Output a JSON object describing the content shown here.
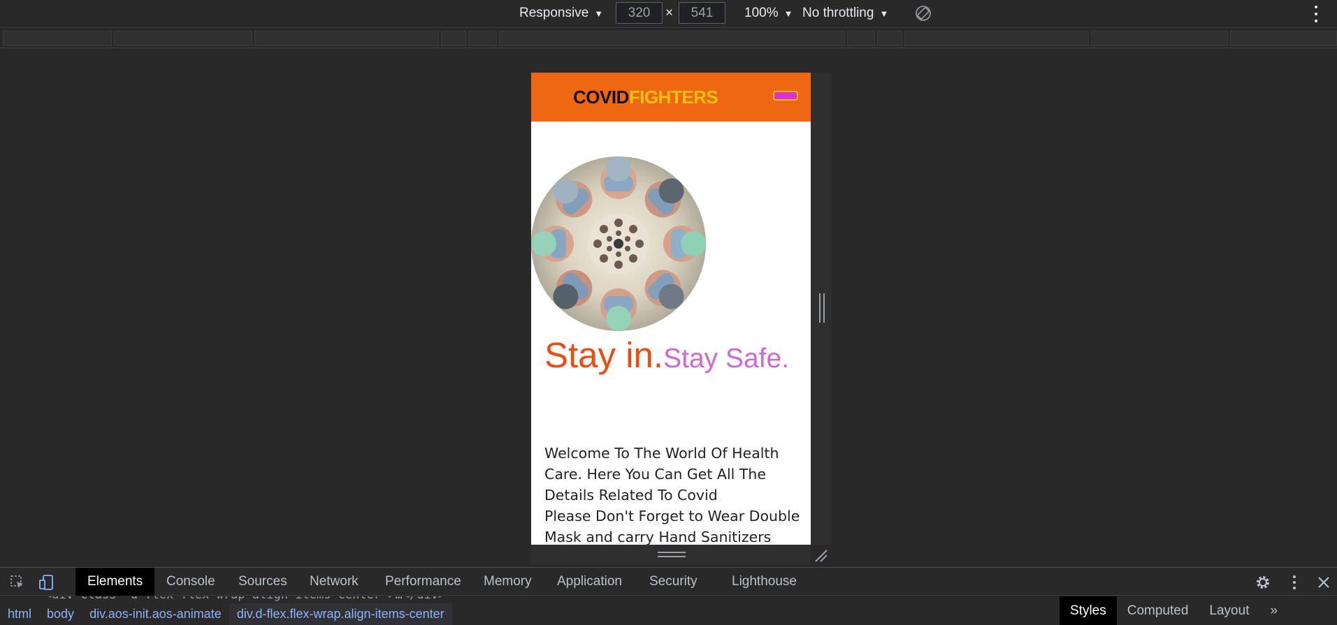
{
  "device_toolbar": {
    "device": "Responsive",
    "width": "320",
    "height": "541",
    "separator": "×",
    "zoom": "100%",
    "throttling": "No throttling"
  },
  "site": {
    "brand_part1": "COVID",
    "brand_part2": "FIGHTERS",
    "tagline_part1": "Stay in.",
    "tagline_part2": "Stay Safe.",
    "welcome_line1": "Welcome To The World Of Health Care. Here You Can Get All The Details Related To Covid",
    "welcome_line2": "Please Don't Forget to Wear Double Mask and carry Hand Sanitizers with you whenever you are going out.",
    "colors": {
      "header_bg": "#ef6713",
      "brand_dark": "#111111",
      "brand_accent": "#f4c20d",
      "tagline_a": "#ef4b0f",
      "tagline_b": "#d166d6",
      "toggle": "#e02fd0"
    }
  },
  "devtools": {
    "tabs": [
      "Elements",
      "Console",
      "Sources",
      "Network",
      "Performance",
      "Memory",
      "Application",
      "Security",
      "Lighthouse"
    ],
    "active_tab": "Elements",
    "breadcrumbs": [
      "html",
      "body",
      "div.aos-init.aos-animate",
      "div.d-flex.flex-wrap.align-items-center"
    ],
    "code_snippet": "<div class=\"d-flex flex-wrap  align-items-center\">…</div>",
    "side_tabs": [
      "Styles",
      "Computed",
      "Layout"
    ],
    "side_active": "Styles",
    "more_symbol": "»"
  }
}
